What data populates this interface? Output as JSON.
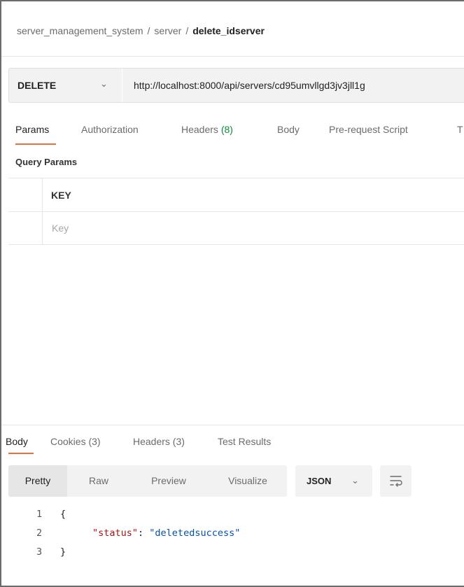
{
  "breadcrumb": {
    "collection": "server_management_system",
    "folder": "server",
    "request": "delete_idserver",
    "separator": "/"
  },
  "request": {
    "method": "DELETE",
    "url": "http://localhost:8000/api/servers/cd95umvllgd3jv3jll1g"
  },
  "request_tabs": {
    "params": "Params",
    "authorization": "Authorization",
    "headers": "Headers",
    "headers_count": "(8)",
    "body": "Body",
    "prerequest": "Pre-request Script",
    "tests": "T"
  },
  "query_params": {
    "title": "Query Params",
    "key_header": "KEY",
    "key_placeholder": "Key"
  },
  "response_tabs": {
    "body": "Body",
    "cookies": "Cookies (3)",
    "headers": "Headers (3)",
    "test_results": "Test Results"
  },
  "view_modes": {
    "pretty": "Pretty",
    "raw": "Raw",
    "preview": "Preview",
    "visualize": "Visualize",
    "format": "JSON"
  },
  "response_body": {
    "lines": [
      {
        "no": "1",
        "text": "{"
      },
      {
        "no": "2",
        "key": "\"status\"",
        "colon": ": ",
        "value": "\"deletedsuccess\""
      },
      {
        "no": "3",
        "text": "}"
      }
    ]
  },
  "colors": {
    "accent": "#f26b3a",
    "count_green": "#0c8a3a",
    "json_key": "#a31515",
    "json_string": "#0451a5"
  }
}
